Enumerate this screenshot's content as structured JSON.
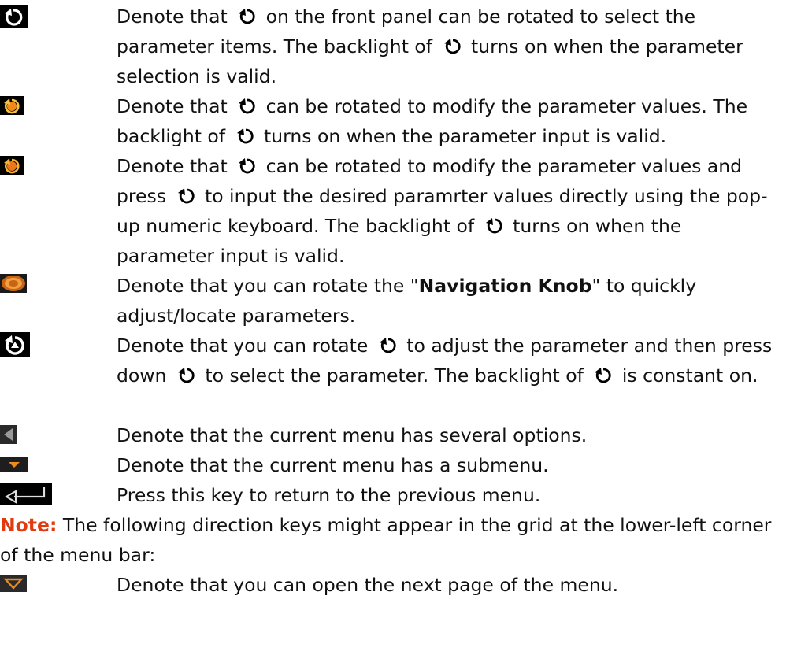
{
  "rows": [
    {
      "icon": "knob-select-icon",
      "parts": [
        "Denote that",
        "on the front panel can be rotated to select the parameter items. The backlight of",
        "turns on when the parameter selection is valid."
      ]
    },
    {
      "icon": "knob-modify-icon",
      "parts": [
        "Denote that",
        "can be rotated to modify the parameter values. The backlight of",
        "turns on when the parameter input is valid."
      ]
    },
    {
      "icon": "knob-modify-keypad-icon",
      "parts": [
        "Denote that",
        "can be rotated to modify the parameter values and press",
        "to input the desired paramrter values directly using the pop-up numeric keyboard. The backlight of",
        "turns on when the parameter input is valid."
      ]
    },
    {
      "icon": "navigation-knob-icon",
      "pre": "Denote that you can rotate the \"",
      "bold": "Navigation Knob",
      "post": "\" to quickly adjust/locate parameters."
    },
    {
      "icon": "knob-adjust-press-icon",
      "parts": [
        "Denote that you can rotate",
        "to adjust the parameter and then press down",
        "to select the parameter. The backlight of",
        "is constant on."
      ]
    },
    {
      "icon": "menu-options-icon",
      "text": "Denote that the current menu has several options."
    },
    {
      "icon": "submenu-icon",
      "text": "Denote that the current menu has a submenu."
    },
    {
      "icon": "return-key-icon",
      "text": "Press this key to return to the previous menu."
    }
  ],
  "note": {
    "label": "Note:",
    "text": "The following direction keys might appear in the grid at the lower-left corner of the menu bar:"
  },
  "last_row": {
    "icon": "next-page-icon",
    "text": "Denote that you can open the next page of the menu."
  },
  "colors": {
    "note_label": "#e03a0e",
    "icon_orange": "#f08a1a"
  }
}
